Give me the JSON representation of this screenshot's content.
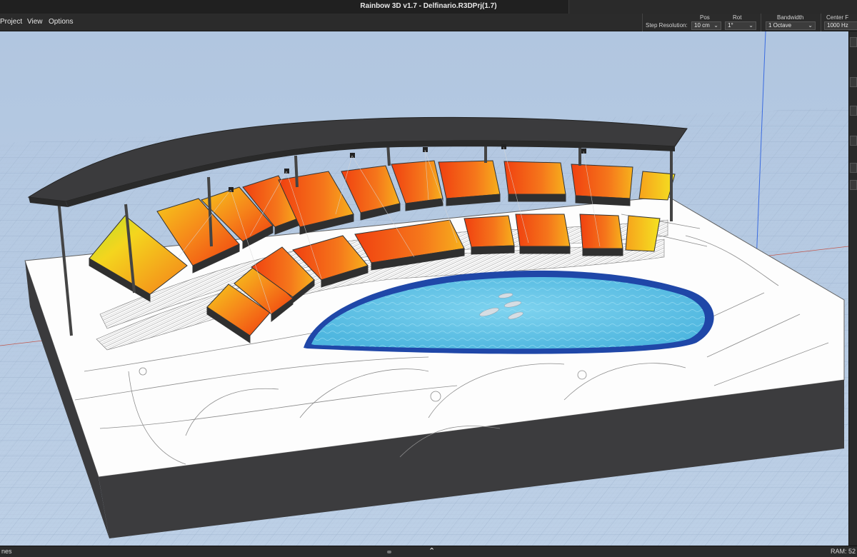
{
  "window": {
    "title": "Rainbow 3D v1.7   -   Delfinario.R3DPrj(1.7)"
  },
  "menu": [
    {
      "label": "Project"
    },
    {
      "label": "View"
    },
    {
      "label": "Options"
    }
  ],
  "toolbar": {
    "step_resolution_label": "Step Resolution:",
    "pos_label": "Pos",
    "pos_value": "10 cm",
    "rot_label": "Rot",
    "rot_value": "1°",
    "bandwidth_label": "Bandwidth",
    "bandwidth_value": "1 Octave",
    "center_freq_label": "Center F",
    "center_freq_value": "1000 Hz"
  },
  "statusbar": {
    "left_text": "nes",
    "right_text": "RAM: 52"
  },
  "colors": {
    "sky": "#b3c7e1",
    "grid": "#a5b9d3",
    "roof": "#3c3c3e",
    "water": "#62c3e4",
    "pool_border": "#1f47a8",
    "heat_hot": "#f23b0c",
    "heat_mid": "#f7821a",
    "heat_cool": "#f3d71e"
  }
}
